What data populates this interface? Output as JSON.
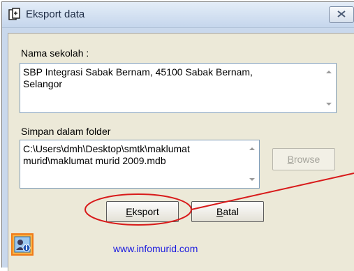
{
  "window": {
    "title": "Eksport data",
    "app_icon": "database-export-icon",
    "close_icon": "close-icon"
  },
  "school": {
    "label": "Nama sekolah :",
    "value_line1": "SBP Integrasi Sabak Bernam, 45100 Sabak Bernam,",
    "value_line2": "Selangor"
  },
  "folder": {
    "label": "Simpan dalam folder",
    "value_line1": "C:\\Users\\dmh\\Desktop\\smtk\\maklumat",
    "value_line2": "murid\\maklumat murid 2009.mdb"
  },
  "buttons": {
    "browse": {
      "prefix": "",
      "accel": "B",
      "rest": "rowse"
    },
    "export": {
      "prefix": "",
      "accel": "E",
      "rest": "ksport"
    },
    "cancel": {
      "prefix": "",
      "accel": "B",
      "rest": "atal"
    }
  },
  "footer": {
    "link_text": "www.infomurid.com",
    "logo_icon": "user-info-badge-icon"
  },
  "colors": {
    "annotation": "#d81a1a",
    "link": "#1a1adf",
    "client_bg": "#ece9d8"
  }
}
